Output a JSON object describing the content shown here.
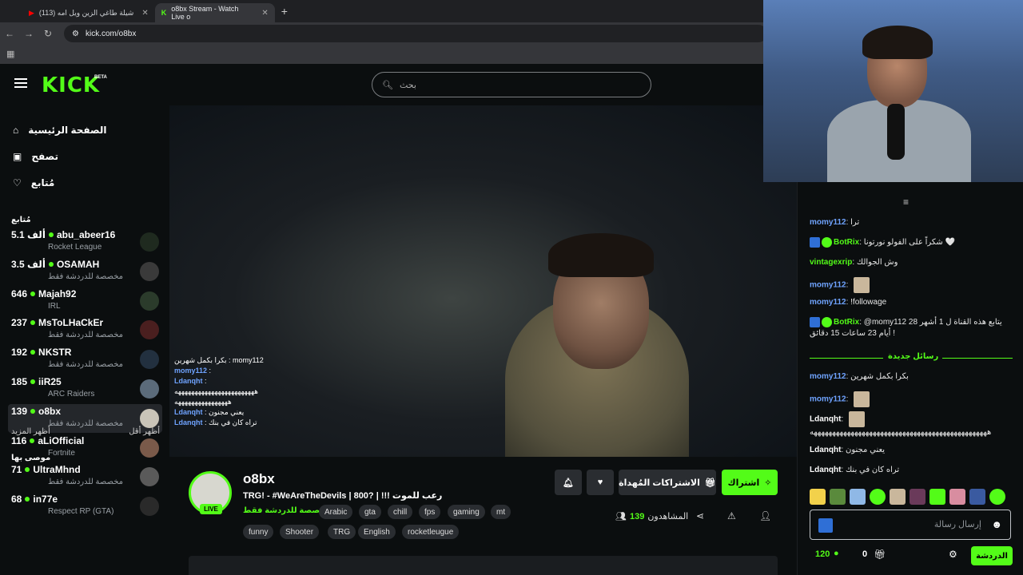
{
  "browser": {
    "tabs": [
      {
        "label": "(113) شيلة طاغي الزين ويل امه",
        "active": false
      },
      {
        "label": "o8bx Stream - Watch Live o",
        "active": true
      }
    ],
    "url": "kick.com/o8bx"
  },
  "header": {
    "logo": "KICK",
    "beta": "BETA",
    "search_placeholder": "بحث"
  },
  "sidebar": {
    "nav": [
      {
        "label": "الصفحة الرئيسية",
        "icon": "home-icon"
      },
      {
        "label": "تصفح",
        "icon": "browse-icon"
      },
      {
        "label": "مُتابع",
        "icon": "heart-icon"
      }
    ],
    "following_title": "مُتابع",
    "channels": [
      {
        "name": "abu_abeer16",
        "viewers": "5.1 ألف",
        "sub": "Rocket League"
      },
      {
        "name": "OSAMAH",
        "viewers": "3.5 ألف",
        "sub": "مخصصة للدردشة فقط"
      },
      {
        "name": "Majah92",
        "viewers": "646",
        "sub": "IRL"
      },
      {
        "name": "MsToLHaCkEr",
        "viewers": "237",
        "sub": "مخصصة للدردشة فقط"
      },
      {
        "name": "NKSTR",
        "viewers": "192",
        "sub": "مخصصة للدردشة فقط"
      },
      {
        "name": "iiR25",
        "viewers": "185",
        "sub": "ARC Raiders"
      },
      {
        "name": "o8bx",
        "viewers": "139",
        "sub": "مخصصة للدردشة فقط"
      },
      {
        "name": "aLiOfficial",
        "viewers": "116",
        "sub": "Fortnite"
      },
      {
        "name": "UltraMhnd",
        "viewers": "71",
        "sub": "مخصصة للدردشة فقط"
      },
      {
        "name": "in77e",
        "viewers": "68",
        "sub": "Respect RP (GTA)"
      }
    ],
    "show_more": "أظهر المزيد",
    "show_less": "أظهر أقل",
    "recommended_title": "موصى بها"
  },
  "video_chat": [
    {
      "user": "",
      "text": "بكرا بكمل شهرين : momy112"
    },
    {
      "user": "momy112",
      "text": ":"
    },
    {
      "user": "Ldanqht",
      "text": ":"
    },
    {
      "user": "",
      "text": "ههههههههههههههههههههههههه"
    },
    {
      "user": "",
      "text": "ههههههههههههههههه"
    },
    {
      "user": "Ldanqht",
      "text": ": يعني مجنون"
    },
    {
      "user": "Ldanqht",
      "text": ": تراه كان في بنك"
    }
  ],
  "stream": {
    "name": "o8bx",
    "live": "LIVE",
    "title": "TRG! - #WeAreTheDevils | 800? | !!! رعب للموت",
    "category": "مخصصة للدردشة فقط",
    "tags_row1": [
      "Arabic",
      "gta",
      "chill",
      "fps",
      "gaming",
      "mt"
    ],
    "tags_row2": [
      "funny",
      "Shooter",
      "TRG",
      "English",
      "rocketleugue"
    ],
    "subscribe": "اشتراك",
    "gift_subs": "الاشتراكات المُهداة",
    "viewers_label": "المشاهدون",
    "viewers_count": "139"
  },
  "chat": {
    "messages": [
      {
        "user": "momy112",
        "color": "#6fa3ff",
        "text": "ترا"
      },
      {
        "user": "BotRix",
        "color": "#53fc18",
        "text": "شكراً على الفولو نورتونا 🤍"
      },
      {
        "user": "vintagexrip",
        "color": "#53fc18",
        "text": "وش الجوالك"
      },
      {
        "user": "momy112",
        "color": "#6fa3ff",
        "text": ""
      },
      {
        "user": "momy112",
        "color": "#6fa3ff",
        "text": "!followage"
      },
      {
        "user": "BotRix",
        "color": "#53fc18",
        "text": "@momy112 يتابع هذه القناة ل 1 أشهر 28 أيام 23 ساعات 15 دقائق !"
      },
      {
        "user": "momy112",
        "color": "#6fa3ff",
        "text": "بكرا بكمل شهرين"
      },
      {
        "user": "momy112",
        "color": "#6fa3ff",
        "text": ""
      },
      {
        "user": "Ldanqht",
        "color": "#fff",
        "text": ""
      },
      {
        "user": "",
        "color": "#fff",
        "text": "ههههههههههههههههههههههههههههههههههههههههههههههههه"
      },
      {
        "user": "Ldanqht",
        "color": "#fff",
        "text": "يعني مجنون"
      },
      {
        "user": "Ldanqht",
        "color": "#fff",
        "text": "تراه كان في بنك"
      }
    ],
    "new_messages": "رسائل جديدة",
    "input_placeholder": "إرسال رسالة",
    "points": "120",
    "gift_count": "0",
    "chat_button": "الدردشة"
  },
  "colors": {
    "accent": "#53fc18",
    "bg": "#0b0e0f"
  }
}
